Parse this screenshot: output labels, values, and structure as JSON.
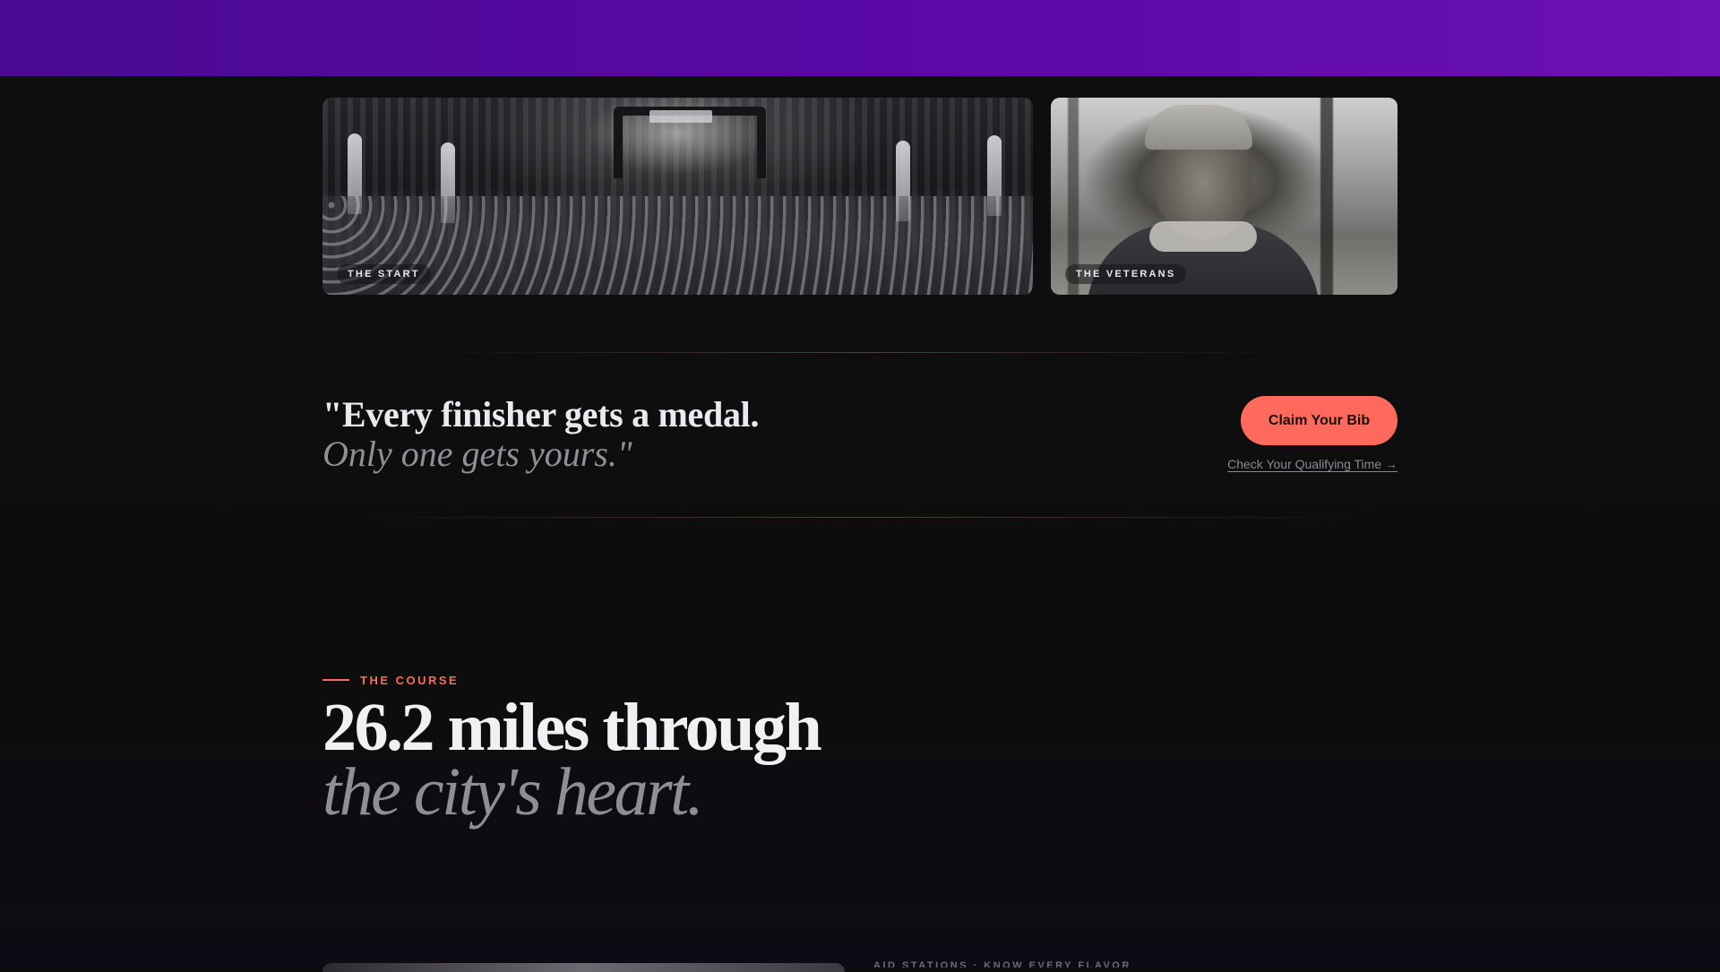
{
  "gallery": {
    "cards": [
      {
        "label": "THE START"
      },
      {
        "label": "THE VETERANS"
      }
    ]
  },
  "quote": {
    "line1": "\"Every finisher gets a medal.",
    "line2": "Only one gets yours.\""
  },
  "cta": {
    "button_label": "Claim Your Bib",
    "link_label": "Check Your Qualifying Time →"
  },
  "course": {
    "eyebrow": "THE COURSE",
    "title_line1": "26.2 miles through",
    "title_line2": "the city's heart.",
    "next_label": "AID STATIONS · KNOW EVERY FLAVOR"
  },
  "colors": {
    "accent": "#ff6a5c",
    "header_gradient_start": "#4a0a93",
    "header_gradient_end": "#6b12b3",
    "background": "#0d0d0e"
  }
}
